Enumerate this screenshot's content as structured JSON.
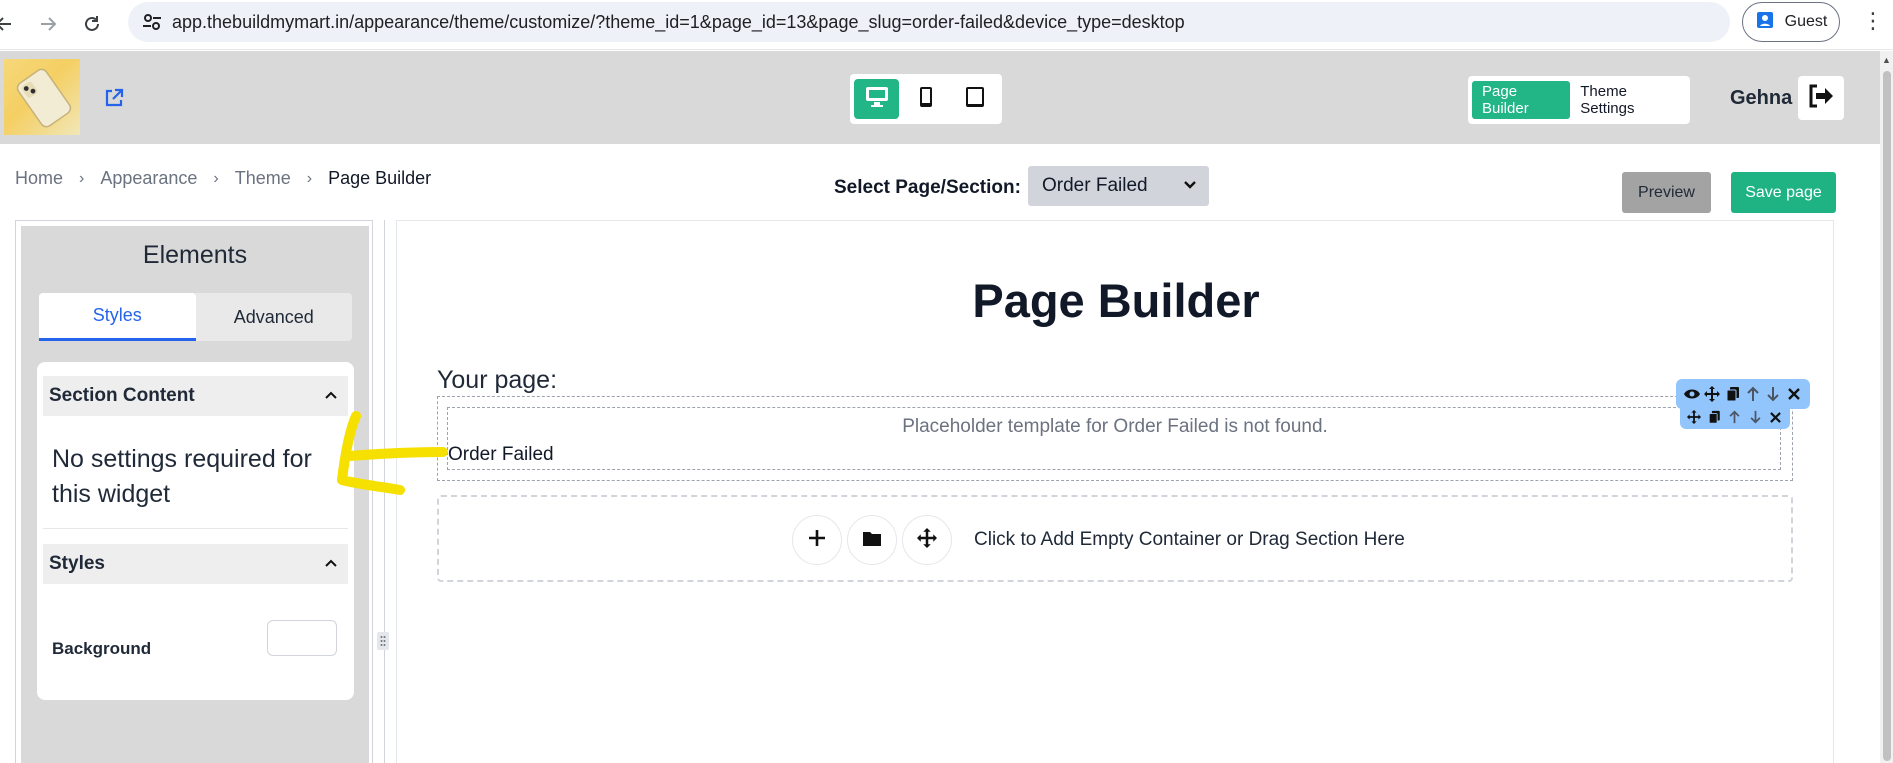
{
  "browser": {
    "url": "app.thebuildmymart.in/appearance/theme/customize/?theme_id=1&page_id=13&page_slug=order-failed&device_type=desktop",
    "profile_label": "Guest"
  },
  "header": {
    "device_buttons": [
      "desktop-icon",
      "mobile-icon",
      "tablet-icon"
    ],
    "active_device": "desktop",
    "mode_tabs": {
      "page_builder": "Page Builder",
      "theme_settings": "Theme Settings"
    },
    "user_name": "Gehna"
  },
  "breadcrumb": {
    "items": [
      "Home",
      "Appearance",
      "Theme",
      "Page Builder"
    ]
  },
  "toolbar": {
    "select_label": "Select Page/Section:",
    "selected_page": "Order Failed",
    "preview_label": "Preview",
    "save_label": "Save page"
  },
  "sidebar": {
    "title": "Elements",
    "tabs": {
      "styles": "Styles",
      "advanced": "Advanced"
    },
    "section_content_title": "Section Content",
    "note": "No settings required for this widget",
    "styles_title": "Styles",
    "background_label": "Background"
  },
  "canvas": {
    "title": "Page Builder",
    "your_page_label": "Your page:",
    "placeholder_msg": "Placeholder template for Order Failed is not found.",
    "widget_text": "Order Failed",
    "add_zone_text": "Click to Add Empty Container or Drag Section Here"
  },
  "colors": {
    "accent": "#22b586",
    "header_bg": "#d9d9d9",
    "toolbar_blue": "#93c5fd",
    "annotation_yellow": "#f5e000"
  }
}
